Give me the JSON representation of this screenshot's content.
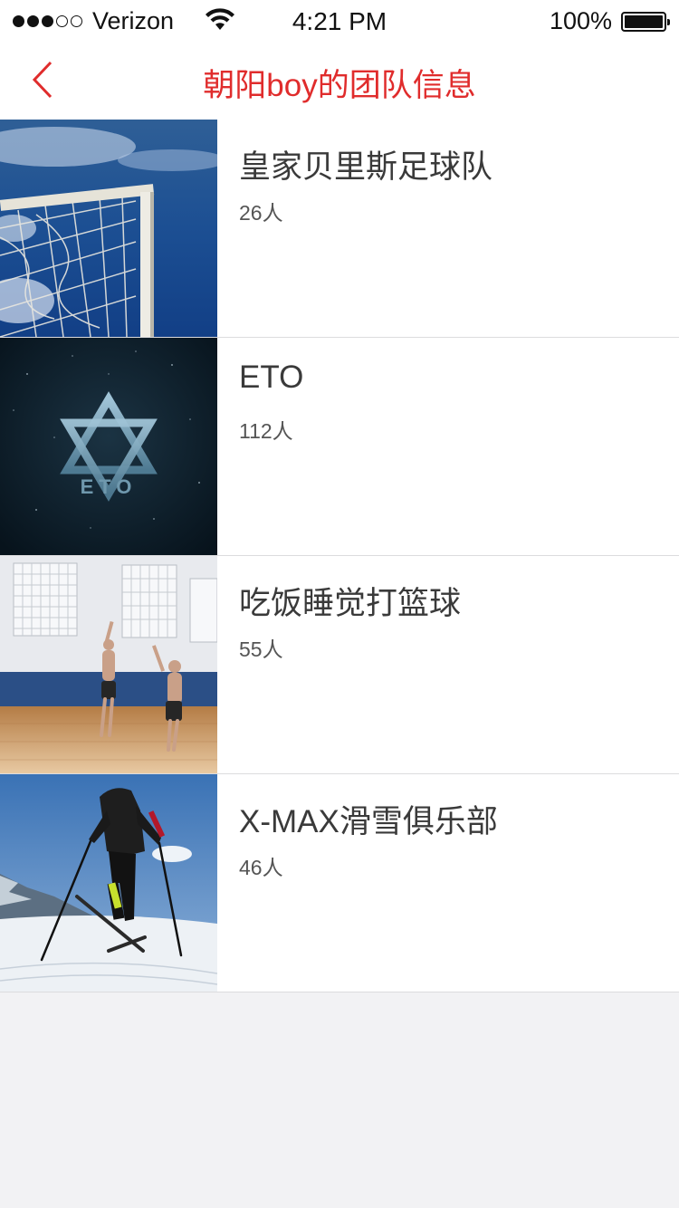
{
  "status_bar": {
    "carrier": "Verizon",
    "time": "4:21 PM",
    "battery": "100%",
    "signal_bars": 3,
    "signal_total": 5,
    "wifi_icon": "wifi-icon",
    "battery_level": 1.0
  },
  "nav": {
    "title": "朝阳boy的团队信息",
    "back_icon": "chevron-left-icon",
    "accent_color": "#e02c2c"
  },
  "teams": [
    {
      "name": "皇家贝里斯足球队",
      "count": "26人",
      "thumbnail": "soccer-goal-net-photo"
    },
    {
      "name": "ETO",
      "count": "112人",
      "thumbnail": "eto-star-logo"
    },
    {
      "name": "吃饭睡觉打篮球",
      "count": "55人",
      "thumbnail": "basketball-gym-photo"
    },
    {
      "name": "X-MAX滑雪俱乐部",
      "count": "46人",
      "thumbnail": "cross-country-skier-photo"
    }
  ]
}
